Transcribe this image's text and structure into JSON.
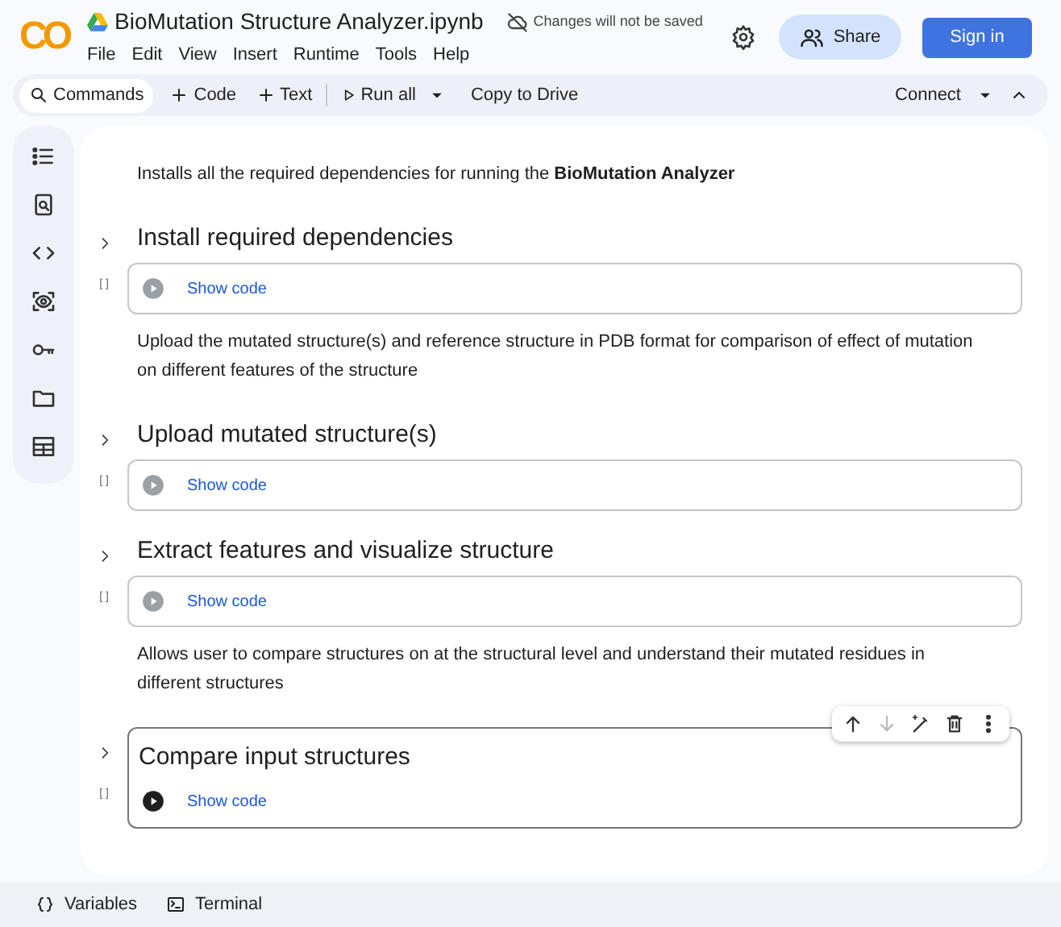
{
  "header": {
    "logo": "CO",
    "title": "BioMutation Structure Analyzer.ipynb",
    "save_notice": "Changes will not be saved",
    "menu": [
      "File",
      "Edit",
      "View",
      "Insert",
      "Runtime",
      "Tools",
      "Help"
    ],
    "share": "Share",
    "sign_in": "Sign in"
  },
  "toolbar": {
    "items": [
      {
        "kind": "search",
        "label": "Commands"
      },
      {
        "kind": "add",
        "label": "Code"
      },
      {
        "kind": "add",
        "label": "Text"
      },
      {
        "kind": "run",
        "label": "Run all"
      },
      {
        "kind": "plain",
        "label": "Copy to Drive"
      }
    ],
    "connect": "Connect"
  },
  "sidebar": {
    "items": [
      {
        "kind": "toc"
      },
      {
        "kind": "find"
      },
      {
        "kind": "code"
      },
      {
        "kind": "eye"
      },
      {
        "kind": "key"
      },
      {
        "kind": "folder"
      },
      {
        "kind": "table"
      }
    ]
  },
  "cells": [
    {
      "kind": "text",
      "text": "Installs all the required dependencies for running the **BioMutation Analyzer**"
    },
    {
      "kind": "section",
      "title": "Install required dependencies",
      "bracket": "[ ]",
      "show_code": "Show code",
      "selected": false
    },
    {
      "kind": "text",
      "text": "Upload the mutated structure(s) and reference structure in PDB format for comparison of effect of mutation on different features of the structure"
    },
    {
      "kind": "section",
      "title": "Upload mutated structure(s)",
      "bracket": "[ ]",
      "show_code": "Show code",
      "selected": false
    },
    {
      "kind": "section",
      "title": "Extract features and visualize structure",
      "bracket": "[ ]",
      "show_code": "Show code",
      "selected": false
    },
    {
      "kind": "text",
      "text": "Allows user to compare structures on at the structural level and understand their mutated residues in different structures"
    },
    {
      "kind": "section",
      "title": "Compare input structures",
      "bracket": "[ ]",
      "show_code": "Show code",
      "selected": true
    }
  ],
  "cell_toolbar": [
    {
      "kind": "up",
      "disabled": false
    },
    {
      "kind": "down",
      "disabled": true
    },
    {
      "kind": "magic",
      "disabled": false
    },
    {
      "kind": "delete",
      "disabled": false
    },
    {
      "kind": "more",
      "disabled": false
    }
  ],
  "bottom_bar": [
    {
      "kind": "variables",
      "label": "Variables"
    },
    {
      "kind": "terminal",
      "label": "Terminal"
    }
  ]
}
